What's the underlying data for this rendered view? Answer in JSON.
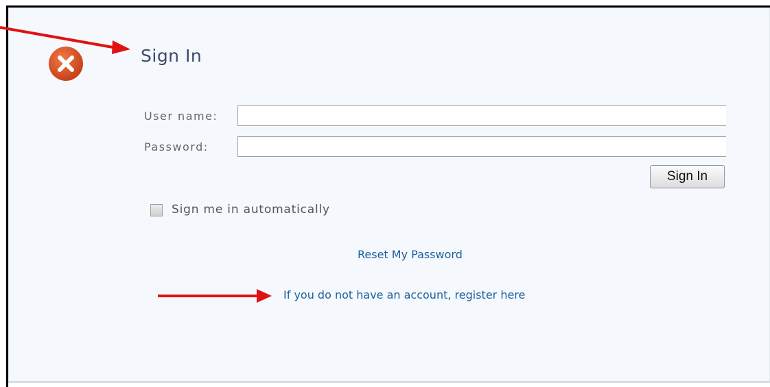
{
  "signin": {
    "title": "Sign In",
    "username_label": "User name:",
    "password_label": "Password:",
    "username_value": "",
    "password_value": "",
    "button_label": "Sign In",
    "remember_label": "Sign me in automatically",
    "remember_checked": false,
    "reset_link": "Reset My Password",
    "register_link": "If you do not have an account, register here"
  },
  "icons": {
    "error": "close-icon",
    "arrow": "arrow-right-icon"
  },
  "colors": {
    "error_icon": "#d9501f",
    "annotation_arrow": "#e01212",
    "link": "#1b5f9e",
    "title": "#3a4a66"
  }
}
